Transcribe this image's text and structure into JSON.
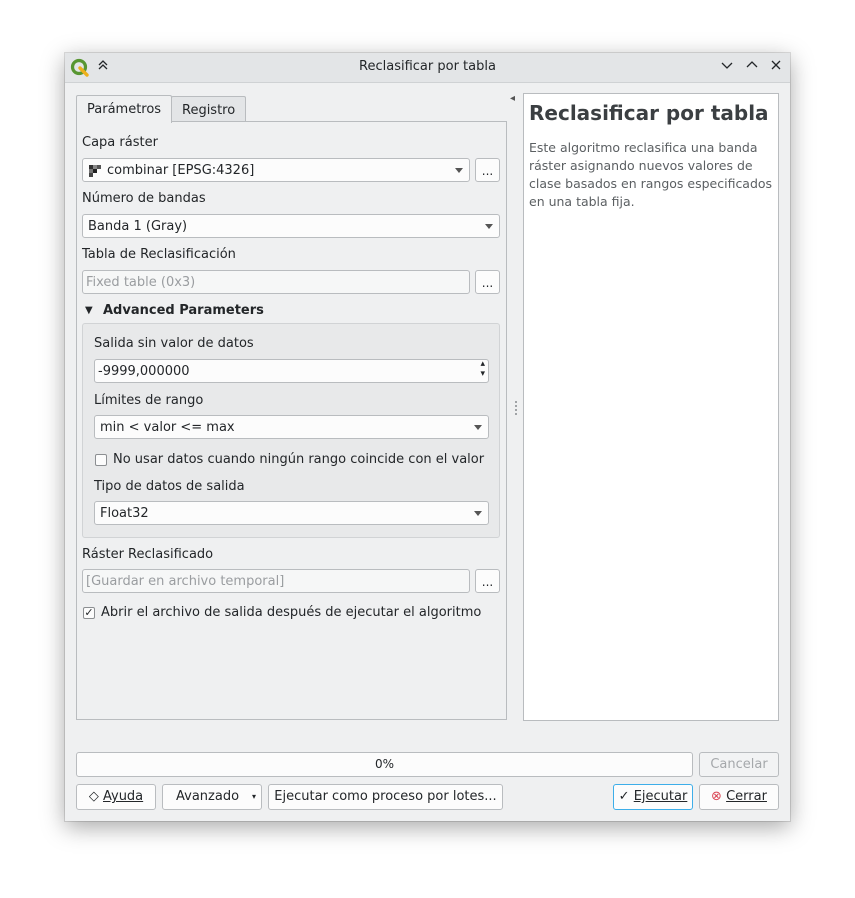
{
  "window": {
    "title": "Reclasificar por tabla"
  },
  "tabs": [
    {
      "label": "Parámetros"
    },
    {
      "label": "Registro"
    }
  ],
  "params": {
    "raster_layer": {
      "label": "Capa ráster",
      "value": "combinar [EPSG:4326]",
      "button": "..."
    },
    "band": {
      "label": "Número de bandas",
      "value": "Banda 1 (Gray)"
    },
    "table": {
      "label": "Tabla de Reclasificación",
      "placeholder": "Fixed table (0x3)",
      "button": "..."
    },
    "advanced": {
      "title": "Advanced Parameters",
      "nodata": {
        "label": "Salida sin valor de datos",
        "value": "-9999,000000"
      },
      "range": {
        "label": "Límites de rango",
        "value": "min < valor <= max"
      },
      "no_match": {
        "label": "No usar datos cuando ningún rango coincide con el valor",
        "checked": false
      },
      "dtype": {
        "label": "Tipo de datos de salida",
        "value": "Float32"
      }
    },
    "output": {
      "label": "Ráster Reclasificado",
      "placeholder": "[Guardar en archivo temporal]",
      "button": "..."
    },
    "open_output": {
      "label": "Abrir el archivo de salida después de ejecutar el algoritmo",
      "checked": true,
      "mark": "✓"
    }
  },
  "help": {
    "title": "Reclasificar por tabla",
    "text": "Este algoritmo reclasifica una banda ráster asignando nuevos valores de clase basados en rangos especificados en una tabla fija."
  },
  "progress": {
    "value_text": "0%",
    "value": 0,
    "cancel": "Cancelar"
  },
  "buttons": {
    "help": "Ayuda",
    "advanced": "Avanzado",
    "batch": "Ejecutar como proceso por lotes...",
    "run": "Ejecutar",
    "close": "Cerrar"
  },
  "icons": {
    "keep_above": "⌃",
    "minimize": "⌄",
    "maximize": "⌃",
    "close": "✕",
    "run": "✓",
    "close_btn": "⊗",
    "help": "◇",
    "collapse": "▼",
    "collapse_panel": "◂",
    "spin_up": "▴",
    "spin_down": "▾"
  },
  "colors": {
    "accent": "#3daee9",
    "close_red": "#da4453",
    "qgis_green": "#589632",
    "qgis_yellow": "#eeb01c"
  }
}
